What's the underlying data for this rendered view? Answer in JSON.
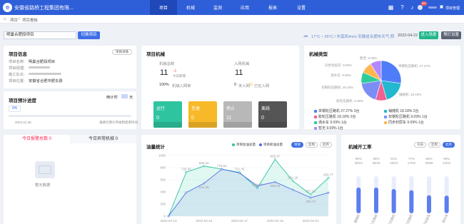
{
  "app": {
    "name": "安徽省路桥工程集团有限..."
  },
  "nav": {
    "items": [
      {
        "label": "项目",
        "active": true
      },
      {
        "label": "机械",
        "active": false
      },
      {
        "label": "监测",
        "active": false
      },
      {
        "label": "应用",
        "active": false
      },
      {
        "label": "报表",
        "active": false
      },
      {
        "label": "设置",
        "active": false
      }
    ]
  },
  "topbar": {
    "notification_count": "99+",
    "manage_label": "项目管理"
  },
  "breadcrumb": {
    "home": "项目",
    "sep": "/",
    "current": "项目看板"
  },
  "search": {
    "value": "明巢合肥段项目",
    "switch_label": "切换项目"
  },
  "weather": {
    "text": "17°C ~ 26°C / 东南风4m/s  安徽省合肥市天气  阴",
    "date": "2022-04-22",
    "enter_label": "进入场景",
    "settings_label": "预灯设置"
  },
  "project": {
    "title": "项目信息",
    "detail_label": "项目详情",
    "fields": [
      {
        "label": "项目名称:",
        "value": "明巢合肥段项目"
      },
      {
        "label": "项目经理:",
        "value": ""
      },
      {
        "label": "施工队长:",
        "value": ""
      },
      {
        "label": "项目位置:",
        "value": "安徽省合肥市肥东县"
      }
    ]
  },
  "progress": {
    "title": "项目预计进度",
    "countdown_label": "倒计时",
    "countdown_value": "",
    "countdown_unit": "天",
    "percent_label": "0%",
    "percent": 0,
    "start_date": "2023-11-30",
    "note": "请填写预计开始和结束时间"
  },
  "machines": {
    "title": "项目机械",
    "total_label": "机械总数",
    "total": "11",
    "delta": "↑1",
    "today_label": "今日新增",
    "rate": "100%",
    "rate_label": "机械入网率",
    "network_label": "入网机械",
    "network": "11",
    "in_count": "0",
    "in_label": "未入网",
    "out_count": "11",
    "out_label": "已在入网",
    "tiles": [
      {
        "label": "运行",
        "value": "0",
        "color": "#2ec4a0"
      },
      {
        "label": "怠速",
        "value": "0",
        "color": "#f7b928"
      },
      {
        "label": "停止",
        "value": "11",
        "color": "#b8b8b8"
      },
      {
        "label": "离线",
        "value": "0",
        "color": "#555555"
      }
    ]
  },
  "types": {
    "title": "机械类型",
    "pie_labels": [
      "暂无: 9.09%",
      "同步封层车: 9.09%",
      "洒水车: 9.09%",
      "双钢轮压路机: 18.18%",
      "胶轮压路机: 9.09%",
      "单钢轮压路机: 27.27%",
      "铺摊机: 18.18%"
    ],
    "legend": [
      {
        "name": "单钢轮压路机",
        "pct": "27.27%",
        "count": "3台",
        "color": "#4f7df9"
      },
      {
        "name": "铺摊机",
        "pct": "18.18%",
        "count": "2台",
        "color": "#22b8cf"
      },
      {
        "name": "胶轮压路机",
        "pct": "18.18%",
        "count": "2台",
        "color": "#f06292"
      },
      {
        "name": "双钢轮压路机",
        "pct": "9.09%",
        "count": "1台",
        "color": "#7c8ef6"
      },
      {
        "name": "洒水车",
        "pct": "9.09%",
        "count": "1台",
        "color": "#2ecc9a"
      },
      {
        "name": "同步封层车",
        "pct": "9.09%",
        "count": "1台",
        "color": "#ffb74d"
      },
      {
        "name": "暂无",
        "pct": "9.09%",
        "count": "1台",
        "color": "#b388ff"
      }
    ]
  },
  "warnings": {
    "tab1": "今日报警总数 0",
    "tab2": "今日异常机械 0",
    "empty": "暂无数据"
  },
  "chart_data": [
    {
      "type": "line",
      "title": "油量统计",
      "legend": [
        "项目加油总量",
        "项目耗油总量"
      ],
      "filters": [
        "项目",
        "近周",
        "近月"
      ],
      "x": [
        "2022-04-13",
        "",
        "2022-04-15",
        "",
        "2022-04-17",
        "",
        "2022-04-19",
        "",
        "2022-04-21",
        ""
      ],
      "x_ticks": [
        "2022-04-13",
        "2022-04-15",
        "2022-04-17",
        "2022-04-19",
        "2022-04-21"
      ],
      "ylim": [
        0,
        1000
      ],
      "yticks": [
        0,
        200,
        400,
        600,
        800,
        1000
      ],
      "series": [
        {
          "name": "项目加油总量",
          "color": "#2ec4a0",
          "values": [
            0,
            725.56,
            826.31,
            775.62,
            721.43,
            462.66,
            935.37,
            581.18,
            357.05,
            630.77
          ]
        },
        {
          "name": "项目耗油总量",
          "color": "#4f6ce8",
          "values": [
            0,
            390,
            541.25,
            774,
            712,
            500,
            562.94,
            435,
            305.7,
            386.5
          ]
        }
      ],
      "point_labels": [
        "",
        "725.56",
        "826.31",
        "775.62",
        "721.43",
        "462.66",
        "935.37",
        "581.18",
        "357.05",
        "630.77"
      ],
      "low_labels": [
        "",
        "",
        "541.25",
        "",
        "",
        "",
        "562.94",
        "",
        "305.70",
        ""
      ]
    },
    {
      "type": "bar",
      "title": "机械开工率",
      "filters": [
        "今日",
        "近周",
        "近月"
      ],
      "categories": [
        "铺摊机",
        "单钢轮压路机",
        "双钢轮压路机",
        "胶轮压路机",
        "同步封层车",
        "洒水车"
      ],
      "values": [
        86,
        86,
        81,
        77,
        60,
        59
      ],
      "percent_labels": [
        "86%",
        "86%",
        "81%",
        "77%",
        "60%",
        "59%"
      ],
      "ratio_labels": [
        "38/44",
        "38/44",
        "18/22",
        "17/22",
        "40/66",
        "13/22"
      ],
      "ylim": [
        0,
        100
      ]
    }
  ]
}
